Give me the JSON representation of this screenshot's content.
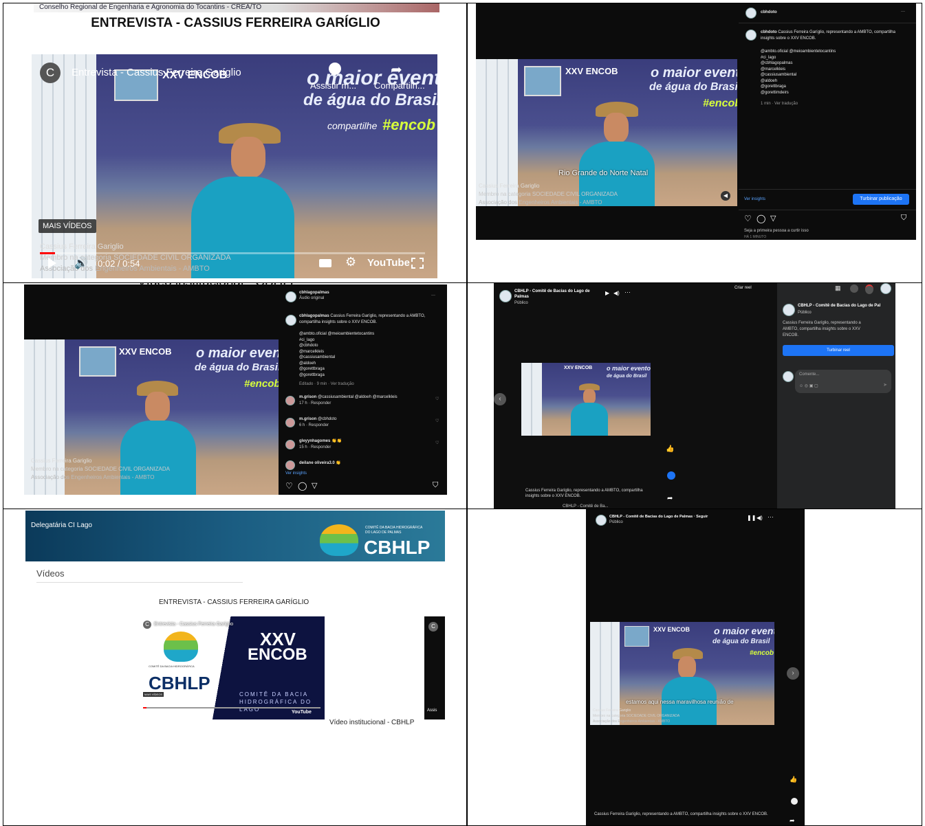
{
  "cell1": {
    "crea_banner": "Conselho Regional de Engenharia e Agronomia do Tocantins - CREA/TO",
    "title": "ENTREVISTA - CASSIUS FERREIRA GARÍGLIO",
    "yt_channel_initial": "C",
    "yt_video_title": "Entrevista - Cassius Ferreira Garíglio",
    "watch_later": "Assistir m...",
    "share": "Compartilh...",
    "banner_title": "XXV ENCOB",
    "maior": "o maior evento",
    "agua": "de água do Brasil !",
    "compartilhe": "compartilhe",
    "encob_tag": "#encob",
    "more_videos": "MAIS VÍDEOS",
    "lower_third_name": "Cassius Ferreira Gariglio",
    "lower_third_l2": "Membro na categoria SOCIEDADE CIVIL ORGANIZADA",
    "lower_third_l3": "Associação dos Engenheiros Ambientais - AMBTO",
    "time": "0:02 / 0:54",
    "youtube": "YouTube",
    "progress": 0.04
  },
  "cell2": {
    "account": "cbhdoto",
    "caption_user": "cbhdoto",
    "caption": "Cassius Ferreira Garíglio, representando a AMBTO, compartilha insights sobre o XXV ENCOB.",
    "tags": [
      "@ambto.oficial @meioambientetocantins",
      "#ci_lago",
      "@cbhlagopalmas",
      "@marcelkleis",
      "@cassiusambiental",
      "@aldoeh",
      "@gorettbraga",
      "@gorettimdeirs"
    ],
    "time_meta": "1 min · Ver tradução",
    "subtitle": "Rio Grande do Norte Natal",
    "lower1": "Cassius Ferreira Gariglio",
    "lower2": "Membro na categoria SOCIEDADE CIVIL ORGANIZADA",
    "lower3": "Associação dos Engenheiros Ambientais - AMBTO",
    "ver_insights": "Ver insights",
    "boost": "Turbinar publicação",
    "first_like": "Seja a primeira pessoa a curtir isso",
    "date": "HÁ 1 MINUTO"
  },
  "cell3": {
    "account": "cbhlagopalmas",
    "audio": "Áudio original",
    "caption_user": "cbhlagopalmas",
    "caption": "Cassius Ferreira Garíglio, representando a AMBTO, compartilha insights sobre o XXV ENCOB.",
    "tags": [
      "@ambto.oficial @meioambientetocantins",
      "#ci_lago",
      "@cbhdoto",
      "@marcelkleis",
      "@cassiusambiental",
      "@aldoeh",
      "@gorettbraga",
      "@gorettbraga"
    ],
    "time_meta": "Editado · 9 min · Ver tradução",
    "comments": [
      {
        "user": "m.grison",
        "text": "@cassiusambiental @aldoeh @marcelkleis",
        "meta": "17 h · Responder"
      },
      {
        "user": "m.grison",
        "text": "@cbhdoto",
        "meta": "6 h · Responder"
      },
      {
        "user": "gleyynhagomes",
        "text": "👏👏",
        "meta": "15 h · Responder"
      },
      {
        "user": "deilane oliveira3.0",
        "text": "👏",
        "meta": ""
      }
    ],
    "ver_insights": "Ver insights",
    "lower1": "Cassius Ferreira Gariglio",
    "lower2": "Membro na categoria SOCIEDADE CIVIL ORGANIZADA",
    "lower3": "Associação dos Engenheiros Ambientais - AMBTO"
  },
  "cell4": {
    "page_name": "CBHLP - Comitê de Bacias do Lago de Palmas",
    "public": "Público",
    "create_reel": "Criar reel",
    "side_page": "CBHLP - Comitê de Bacias do Lago de Pal",
    "side_public": "Público",
    "side_caption": "Cassius Ferreira Garíglio, representando a AMBTO, compartilha insights sobre o XXV ENCOB.",
    "boost_reel": "Turbinar reel",
    "comment_placeholder": "Comente...",
    "bottom_caption": "Cassius Ferreira Garíglio, representando a AMBTO, compartilha insights sobre o XXV ENCOB.",
    "bottom_meta": "CBHLP - Comitê de Ba..."
  },
  "cell5": {
    "delegation": "Delegatária CI Lago",
    "committee_l1": "COMITÊ DA BACIA HIDROGRÁFICA",
    "committee_l2": "DO LAGO DE PALMAS",
    "logo": "CBHLP",
    "videos": "Vídeos",
    "entrevista_title": "ENTREVISTA - CASSIUS FERREIRA GARÍGLIO",
    "thumb_title": "Entrevista - Cassius Ferreira Garíglio",
    "xxv": "XXV",
    "encob": "ENCOB",
    "comite": "COMITÊ DA BACIA HIDROGRÁFICA DO LAGO",
    "mais_videos": "MAIS VÍDEOS",
    "inst_title": "Vídeo institucional - CBHLP",
    "assist": "Assis"
  },
  "cell6": {
    "page_name": "CBHLP - Comitê de Bacias do Lago de Palmas · Seguir",
    "public": "Público",
    "subtitle": "estamos aqui nessa maravilhosa reunião de",
    "lower1": "Cassius Ferreira Gariglio",
    "lower2": "Membro na categoria SOCIEDADE CIVIL ORGANIZADA",
    "lower3": "Associação dos Engenheiros Ambientais - AMBTO",
    "caption": "Cassius Ferreira Garíglio, representando a AMBTO, compartilha insights sobre o XXV ENCOB."
  },
  "overlap_text": "Vídeo institucional - CBHLP"
}
